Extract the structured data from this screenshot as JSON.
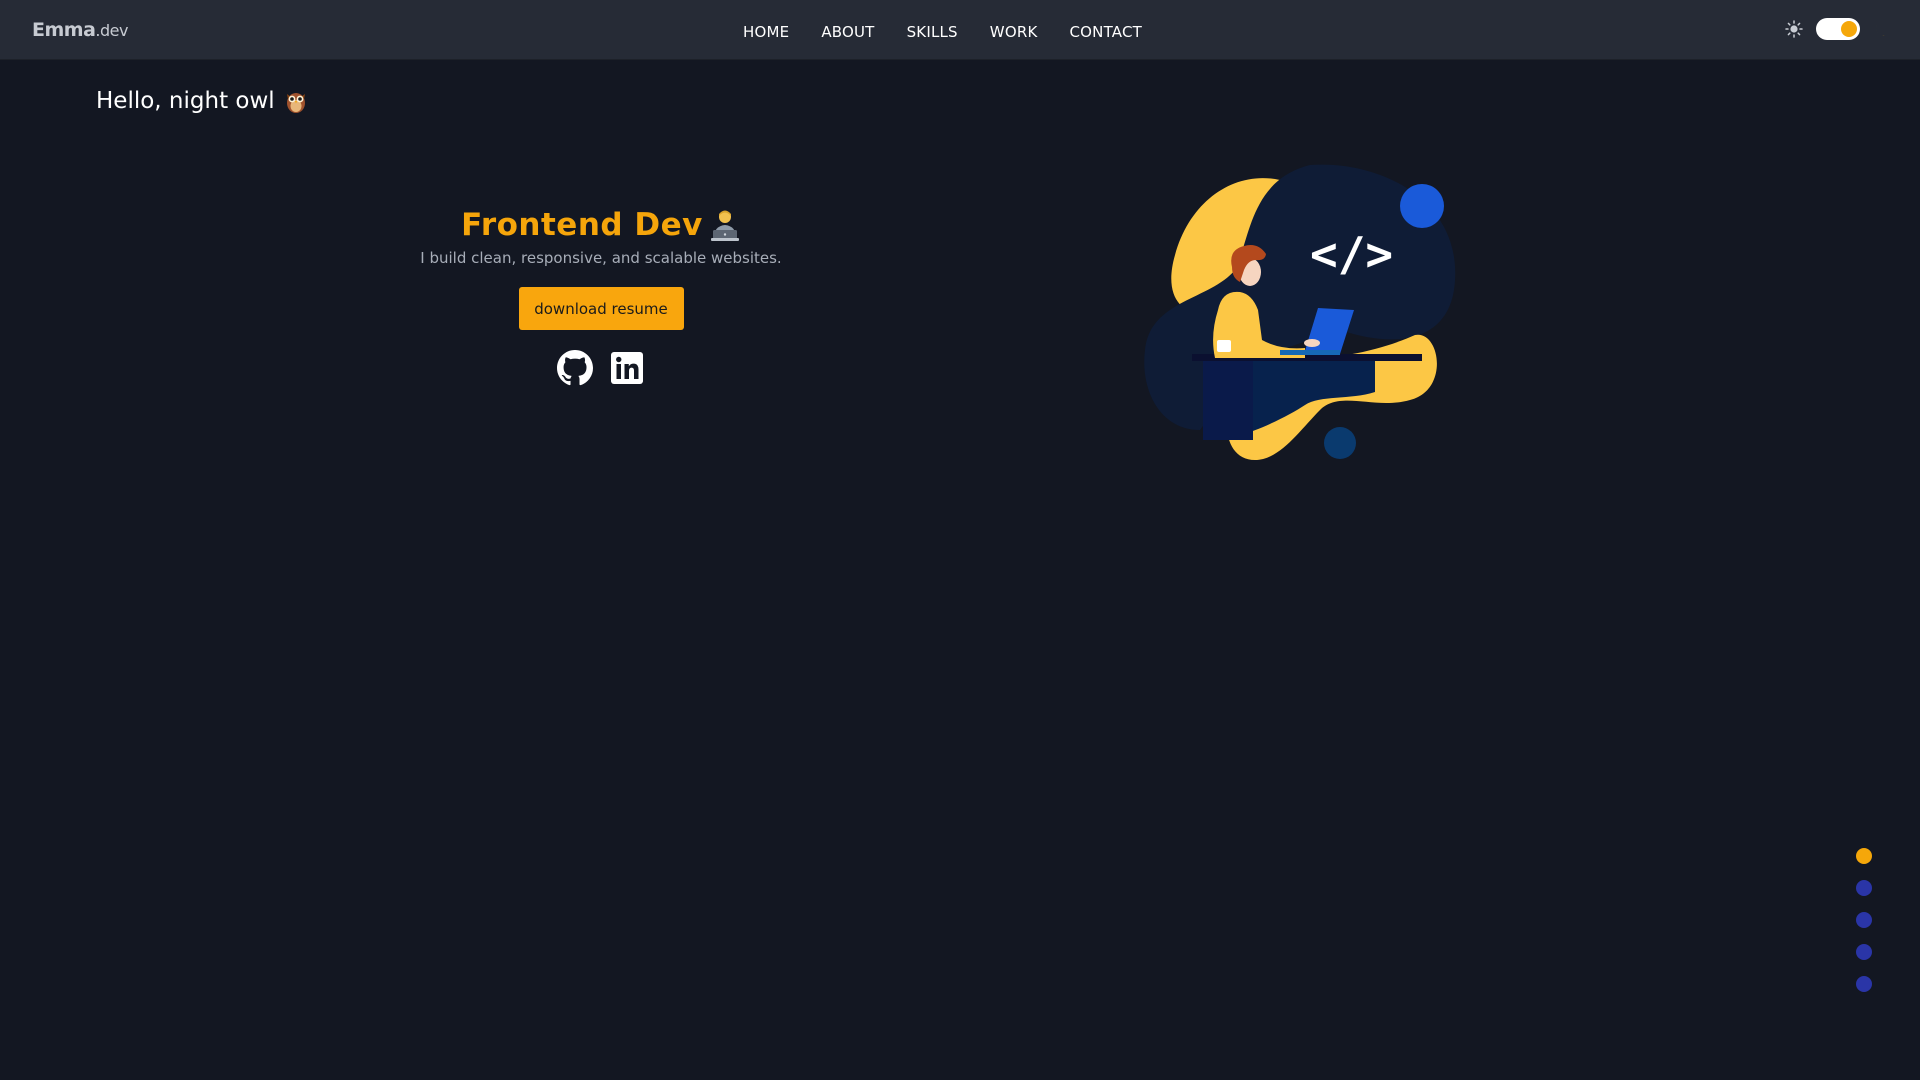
{
  "navbar": {
    "logo_name": "Emma",
    "logo_tld": ".dev",
    "links": [
      {
        "label": "HOME"
      },
      {
        "label": "ABOUT"
      },
      {
        "label": "SKILLS"
      },
      {
        "label": "WORK"
      },
      {
        "label": "CONTACT"
      }
    ],
    "theme": {
      "left_icon": "sun-icon",
      "right_icon": "moon-icon",
      "mode": "dark"
    }
  },
  "greeting": {
    "text": "Hello, night owl",
    "icon": "owl-icon"
  },
  "hero": {
    "title": "Frontend Dev",
    "title_icon": "technologist-icon",
    "subtitle": "I build clean, responsive, and scalable websites.",
    "button_label": "download resume",
    "socials": [
      {
        "icon": "github-icon"
      },
      {
        "icon": "linkedin-icon"
      }
    ]
  },
  "illustration": {
    "code_text": "</>"
  },
  "section_dots": {
    "count": 5,
    "active_index": 0
  },
  "colors": {
    "background": "#131722",
    "navbar": "#262b36",
    "accent": "#f5a50b",
    "dot_inactive": "#2a35a7"
  }
}
